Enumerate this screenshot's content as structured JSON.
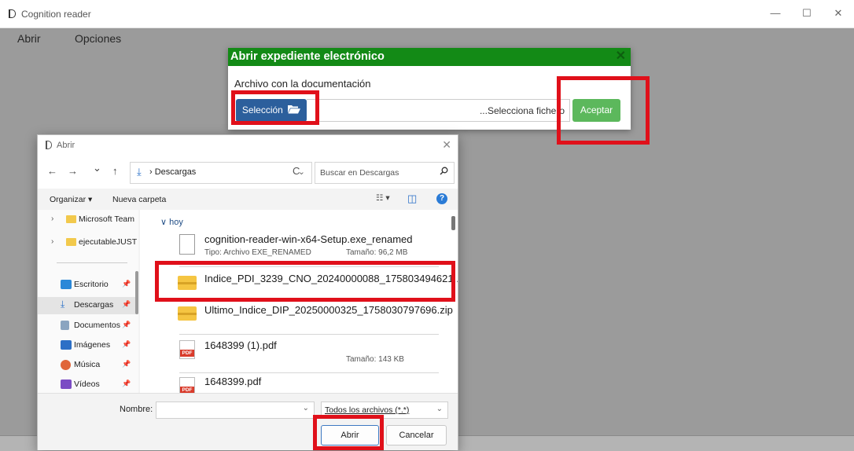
{
  "window": {
    "title": "Cognition reader",
    "minimize": "—",
    "maximize": "☐",
    "close": "✕"
  },
  "menu": {
    "items": [
      {
        "label": "Abrir"
      },
      {
        "label": "Opciones"
      }
    ]
  },
  "modal": {
    "title": "Abrir expediente electrónico",
    "close": "✕",
    "label": "Archivo con la documentación",
    "select_label": "Selección",
    "file_placeholder": "...Selecciona fichero",
    "accept_label": "Aceptar",
    "header_color": "#138a16"
  },
  "dialog": {
    "title": "Abrir",
    "close": "✕",
    "nav": {
      "back": "←",
      "forward": "→",
      "recent": "⌄",
      "up": "↑"
    },
    "path": {
      "separator": "›",
      "folder": "Descargas",
      "chevron": "⌄"
    },
    "refresh": "C",
    "search_placeholder": "Buscar en Descargas",
    "toolbar": {
      "organize": "Organizar ▾",
      "new_folder": "Nueva carpeta",
      "view": "☷ ▾",
      "pane": "◫",
      "help": "?"
    },
    "tree": [
      {
        "label": "Microsoft Team",
        "expander": "›"
      },
      {
        "label": "ejecutableJUST",
        "expander": "›"
      }
    ],
    "quick_access": [
      {
        "label": "Escritorio",
        "pin": "📌",
        "icon": "desktop-icon"
      },
      {
        "label": "Descargas",
        "pin": "📌",
        "icon": "download-icon"
      },
      {
        "label": "Documentos",
        "pin": "📌",
        "icon": "documents-icon"
      },
      {
        "label": "Imágenes",
        "pin": "📌",
        "icon": "pictures-icon"
      },
      {
        "label": "Música",
        "pin": "📌",
        "icon": "music-icon"
      },
      {
        "label": "Vídeos",
        "pin": "📌",
        "icon": "videos-icon"
      }
    ],
    "group": "∨ hoy",
    "files": [
      {
        "name": "cognition-reader-win-x64-Setup.exe_renamed",
        "type": "Tipo: Archivo EXE_RENAMED",
        "size": "Tamaño: 96,2 MB",
        "icon": "document-icon"
      },
      {
        "name": "Indice_PDI_3239_CNO_20240000088_175803494621...",
        "type": "",
        "size": "",
        "icon": "zip-folder-icon"
      },
      {
        "name": "Ultimo_Indice_DIP_20250000325_1758030797696.zip",
        "type": "",
        "size": "",
        "icon": "zip-folder-icon"
      },
      {
        "name": "1648399 (1).pdf",
        "type": "",
        "size": "Tamaño: 143 KB",
        "icon": "pdf-icon"
      },
      {
        "name": "1648399.pdf",
        "type": "",
        "size": "",
        "icon": "pdf-icon"
      }
    ],
    "name_label": "Nombre:",
    "name_value": "",
    "filetype": "Todos los archivos (*.*)",
    "open_label": "Abrir",
    "cancel_label": "Cancelar"
  },
  "pdf_badge": "PDF",
  "highlight_color": "#e0101a"
}
